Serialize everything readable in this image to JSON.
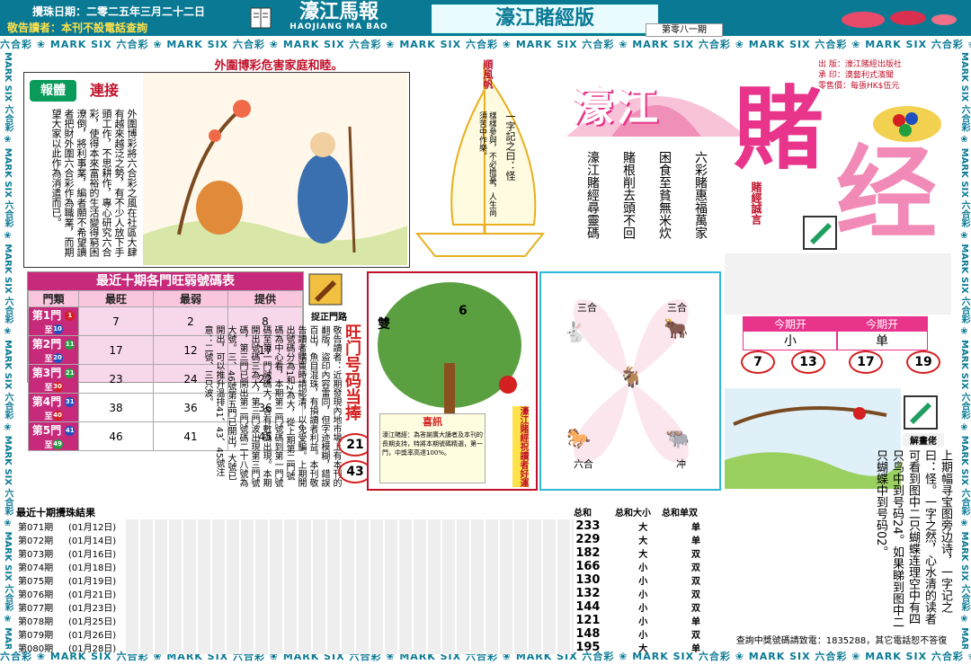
{
  "header": {
    "date_line": "攪珠日期：二零二五年三月二十二日",
    "warning": "敬告讀者：本刊不設電話查詢",
    "newspaper_name": "濠江馬報",
    "newspaper_pinyin": "HAOJIANG MA BAO",
    "edition_title": "濠江賭經版",
    "issue_no": "第零八一期"
  },
  "strip_text": "六合彩 ❀ MARK SIX 六合彩 ❀ MARK SIX 六合彩 ❀ MARK SIX 六合彩 ❀ MARK SIX 六合彩 ❀ MARK SIX 六合彩 ❀ MARK SIX 六合彩 ❀ MARK SIX 六合彩 ❀ MARK SIX 六合彩 ❀ MARK SIX 六合彩 ❀ MARK SIX 六合彩 ❀",
  "vstrip_text": "MARK SIX 六合彩 ❀ MARK SIX 六合彩 ❀ MARK SIX 六合彩 ❀ MARK SIX 六合彩 ❀ MARK SIX 六合彩 ❀ MARK SIX 六合彩 ❀ MARK SIX",
  "publisher": {
    "l1": "出  版：濠江賭經出版社",
    "l2": "承  印：澳藝利式濱聞",
    "l3": "零售價：每張HK$伍元"
  },
  "article": {
    "headline": "外圍博彩危害家庭和睦。",
    "badge1": "報體",
    "badge2": "連接",
    "body": "外圍博彩將六合彩之風在社區大肆有越來越泛之勢，有不少人放下手頭工作，不思耕作，專心研究六合彩，使得本來富裕的生活變得窮困潦倒，將利事業，編者願不希望讀者把財外圍六合彩作為職業，而期望大家以此作為消遣而已。"
  },
  "sail": {
    "label": "順風帆",
    "body": "一字記之曰：怪",
    "poem": "樣樣參與，不必擔憂，人生尚須苦中作樂。"
  },
  "poem": {
    "line1": "六彩賭惠福萬家",
    "line2": "困食至貧無米炊",
    "line3": "賭根削去頭不回",
    "line4": "濠江賭經尋靈碼"
  },
  "big_title": {
    "a": "濠江",
    "b": "賭",
    "c": "经",
    "motto": "賭經誠言"
  },
  "hot_table": {
    "title": "最近十期各門旺弱號碼表",
    "headers": [
      "門類",
      "最旺",
      "最弱",
      "提供"
    ],
    "rows": [
      {
        "label": "第1門",
        "from": "1",
        "to": "10",
        "hot": "7",
        "cold": "2",
        "pick": "8"
      },
      {
        "label": "第2門",
        "from": "11",
        "to": "20",
        "hot": "17",
        "cold": "12",
        "pick": "17"
      },
      {
        "label": "第3門",
        "from": "21",
        "to": "30",
        "hot": "23",
        "cold": "24",
        "pick": "22"
      },
      {
        "label": "第4門",
        "from": "31",
        "to": "40",
        "hot": "38",
        "cold": "36",
        "pick": "36"
      },
      {
        "label": "第5門",
        "from": "41",
        "to": "49",
        "hot": "46",
        "cold": "41",
        "pick": "45"
      }
    ],
    "side_label": "捉正門路"
  },
  "notice": {
    "text": "敬告讀者：近期發現內地市場上有本刊的翻版，盜印內容雷同，但字迹模糊，錯誤百出，魚目混珠，有損讀者利益。本刊敬告讀者購買時請認清，以免受騙。上期開出號碼分為1和2為大，從上期第二門號碼為中心看，本期第二門號碼到第一門號碼至第一門號碼大，各有數碼出現。本期開出號碼三為大，第三門波出現第三門號碼，第三門已開出第二門號碼二十八號為大號。三、46號第五門已開出，大號已開出，可以推升溫排41、43、45號注意：二號、三只波。"
  },
  "hot_gate": {
    "title": "旺门号码当捧",
    "n1": "21",
    "n2": "43"
  },
  "tree": {
    "label_top": "雙",
    "label_num": "6",
    "news_title": "喜訊",
    "news_body": "濠江賭經：為答謝廣大讀者及本刊的長期支持，特將本期號碼精選，第一門，中獎率高達100%。",
    "vertical": "濠江賭經祝讀者好運"
  },
  "animals": {
    "a1": "三合",
    "a2": "三合",
    "a3": "六合",
    "a4": "冲"
  },
  "this_period": {
    "label": "今期开",
    "size_value": "小",
    "odd_value": "单",
    "numbers": [
      "7",
      "13",
      "17",
      "19"
    ]
  },
  "puzzle": {
    "label": "解畫佬",
    "text": "上期幅寻宝图旁边诗，一字记之曰：怪。一字之然，心水清的读者可看到图中二只蝴蝶连理空中有四只鸟中到号码24。如果睇到图中二只蝴蝶中到号码02。"
  },
  "results": {
    "title": "最近十期攪珠結果",
    "head_sum": "总和",
    "head_size": "总和大小",
    "head_odd": "总和单双",
    "rows": [
      {
        "period": "第071期",
        "date": "(01月12日)",
        "sum": "233",
        "size": "大",
        "odd": "单"
      },
      {
        "period": "第072期",
        "date": "(01月14日)",
        "sum": "229",
        "size": "大",
        "odd": "单"
      },
      {
        "period": "第073期",
        "date": "(01月16日)",
        "sum": "182",
        "size": "大",
        "odd": "双"
      },
      {
        "period": "第074期",
        "date": "(01月18日)",
        "sum": "166",
        "size": "小",
        "odd": "双"
      },
      {
        "period": "第075期",
        "date": "(01月19日)",
        "sum": "130",
        "size": "小",
        "odd": "双"
      },
      {
        "period": "第076期",
        "date": "(01月21日)",
        "sum": "132",
        "size": "小",
        "odd": "双"
      },
      {
        "period": "第077期",
        "date": "(01月23日)",
        "sum": "144",
        "size": "小",
        "odd": "双"
      },
      {
        "period": "第078期",
        "date": "(01月25日)",
        "sum": "121",
        "size": "小",
        "odd": "单"
      },
      {
        "period": "第079期",
        "date": "(01月26日)",
        "sum": "148",
        "size": "小",
        "odd": "双"
      },
      {
        "period": "第080期",
        "date": "(01月28日)",
        "sum": "195",
        "size": "大",
        "odd": "单"
      }
    ]
  },
  "footer": {
    "line": "查詢中獎號碼請致電：1835288，其它電話恕不答復"
  },
  "colors": {
    "teal": "#0a7a94",
    "pink": "#e8348a",
    "red": "#d42020"
  }
}
